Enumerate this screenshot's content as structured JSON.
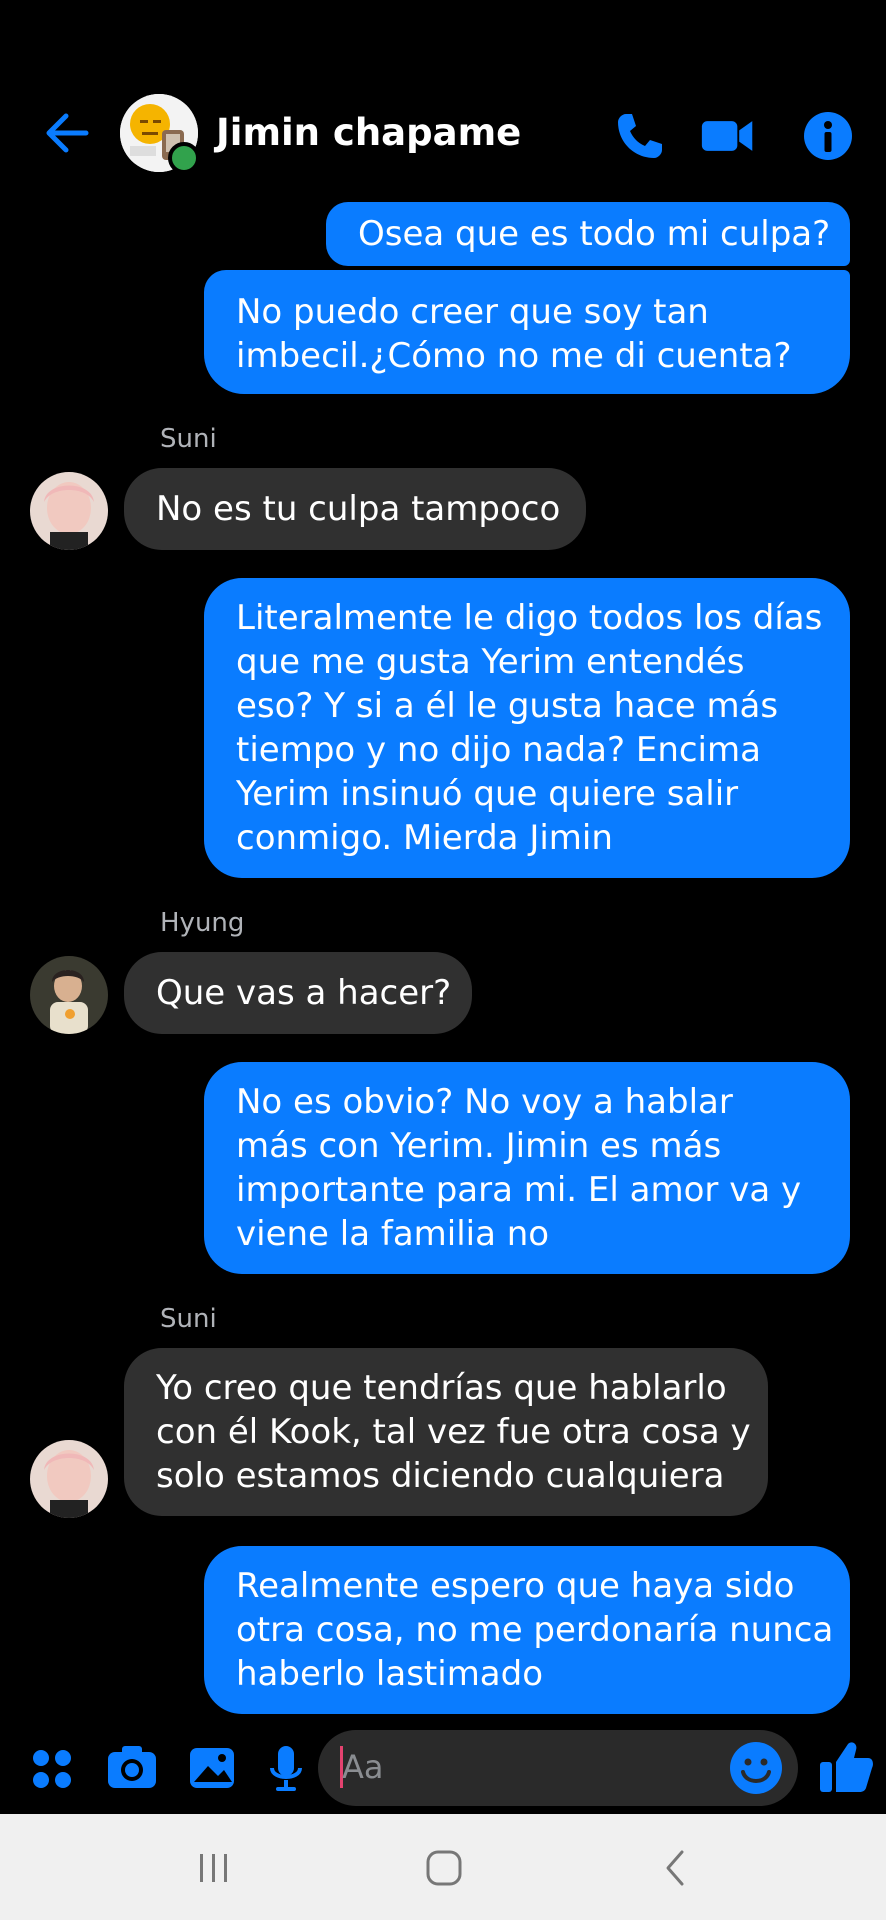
{
  "header": {
    "title": "Jimin chapame",
    "avatar_icon": "emoji-avatar",
    "status": "online"
  },
  "messages": [
    {
      "dir": "out",
      "lines": [
        "Osea que es todo mi culpa?"
      ]
    },
    {
      "dir": "out",
      "lines": [
        "No puedo creer que soy tan",
        "imbecil.¿Cómo no me di cuenta?"
      ]
    },
    {
      "dir": "in",
      "sender": "Suni",
      "lines": [
        "No es tu culpa tampoco"
      ]
    },
    {
      "dir": "out",
      "lines": [
        "Literalmente le digo todos los días",
        "que me gusta Yerim entendés",
        "eso?  Y si a él le gusta hace más",
        "tiempo y no dijo nada? Encima",
        "Yerim insinuó que quiere salir",
        "conmigo. Mierda Jimin"
      ]
    },
    {
      "dir": "in",
      "sender": "Hyung",
      "lines": [
        "Que vas a hacer?"
      ]
    },
    {
      "dir": "out",
      "lines": [
        "No es obvio? No voy a hablar",
        "más con Yerim. Jimin es más",
        "importante para mi. El amor va y",
        "viene la familia no"
      ]
    },
    {
      "dir": "in",
      "sender": "Suni",
      "lines": [
        "Yo creo que tendrías que hablarlo",
        "con él Kook, tal vez fue otra cosa y",
        "solo estamos diciendo cualquiera"
      ]
    },
    {
      "dir": "out",
      "lines": [
        "Realmente espero que haya sido",
        "otra cosa, no me perdonaría nunca",
        "haberlo lastimado"
      ]
    }
  ],
  "composer": {
    "placeholder": "Aa"
  },
  "colors": {
    "accent": "#0a7cff",
    "outgoing": "#0a7cff",
    "incoming": "#303030",
    "background": "#000000"
  }
}
